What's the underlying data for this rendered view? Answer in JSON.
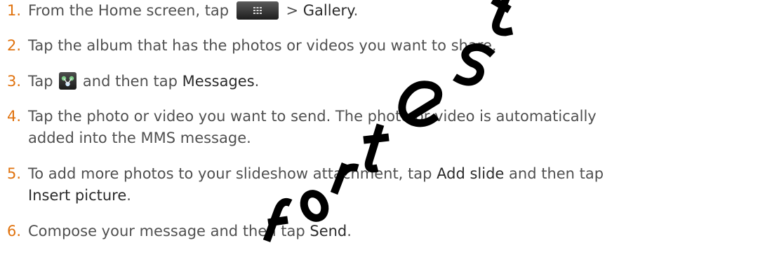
{
  "steps": [
    {
      "number": "1.",
      "text_before": "From the Home screen, tap",
      "icon": "all-apps-button-icon",
      "text_mid": " > ",
      "bold": "Gallery",
      "text_after": "."
    },
    {
      "number": "2.",
      "text": "Tap the album that has the photos or videos you want to share."
    },
    {
      "number": "3.",
      "text_before": "Tap",
      "icon": "share-icon",
      "text_mid": " and then tap ",
      "bold": "Messages",
      "text_after": "."
    },
    {
      "number": "4.",
      "line1": "Tap the photo or video you want to send. The photo or video is automatically",
      "line2": "added into the MMS message."
    },
    {
      "number": "5.",
      "line1_before": "To add more photos to your slideshow attachment, tap ",
      "line1_bold": "Add slide",
      "line1_after": " and then tap",
      "line2_bold": "Insert picture",
      "line2_after": "."
    },
    {
      "number": "6.",
      "text_before": "Compose your message and then tap ",
      "bold": "Send",
      "text_after": "."
    }
  ],
  "colors": {
    "step_number": "#e0720e",
    "body_text": "#505050",
    "emphasis_text": "#2b2b2b",
    "watermark": "#000000"
  },
  "watermark": {
    "icon": "for-test-watermark"
  }
}
